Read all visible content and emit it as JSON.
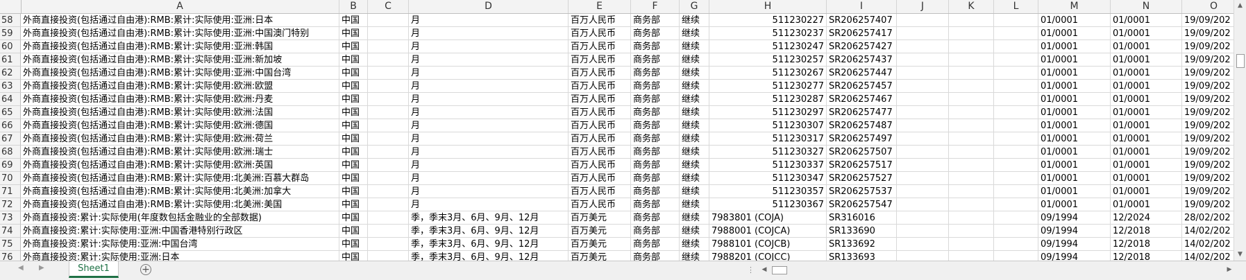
{
  "columns": [
    "A",
    "B",
    "C",
    "D",
    "E",
    "F",
    "G",
    "H",
    "I",
    "J",
    "K",
    "L",
    "M",
    "N",
    "O"
  ],
  "rows": [
    {
      "n": "58",
      "cells": [
        "外商直接投资(包括通过自由港):RMB:累计:实际使用:亚洲:日本",
        "中国",
        "",
        "月",
        "百万人民币",
        "商务部",
        "继续",
        "511230227",
        "SR206257407",
        "",
        "",
        "",
        "01/0001",
        "01/0001",
        "19/09/202"
      ]
    },
    {
      "n": "59",
      "cells": [
        "外商直接投资(包括通过自由港):RMB:累计:实际使用:亚洲:中国澳门特别",
        "中国",
        "",
        "月",
        "百万人民币",
        "商务部",
        "继续",
        "511230237",
        "SR206257417",
        "",
        "",
        "",
        "01/0001",
        "01/0001",
        "19/09/202"
      ]
    },
    {
      "n": "60",
      "cells": [
        "外商直接投资(包括通过自由港):RMB:累计:实际使用:亚洲:韩国",
        "中国",
        "",
        "月",
        "百万人民币",
        "商务部",
        "继续",
        "511230247",
        "SR206257427",
        "",
        "",
        "",
        "01/0001",
        "01/0001",
        "19/09/202"
      ]
    },
    {
      "n": "61",
      "cells": [
        "外商直接投资(包括通过自由港):RMB:累计:实际使用:亚洲:新加坡",
        "中国",
        "",
        "月",
        "百万人民币",
        "商务部",
        "继续",
        "511230257",
        "SR206257437",
        "",
        "",
        "",
        "01/0001",
        "01/0001",
        "19/09/202"
      ]
    },
    {
      "n": "62",
      "cells": [
        "外商直接投资(包括通过自由港):RMB:累计:实际使用:亚洲:中国台湾",
        "中国",
        "",
        "月",
        "百万人民币",
        "商务部",
        "继续",
        "511230267",
        "SR206257447",
        "",
        "",
        "",
        "01/0001",
        "01/0001",
        "19/09/202"
      ]
    },
    {
      "n": "63",
      "cells": [
        "外商直接投资(包括通过自由港):RMB:累计:实际使用:欧洲:欧盟",
        "中国",
        "",
        "月",
        "百万人民币",
        "商务部",
        "继续",
        "511230277",
        "SR206257457",
        "",
        "",
        "",
        "01/0001",
        "01/0001",
        "19/09/202"
      ]
    },
    {
      "n": "64",
      "cells": [
        "外商直接投资(包括通过自由港):RMB:累计:实际使用:欧洲:丹麦",
        "中国",
        "",
        "月",
        "百万人民币",
        "商务部",
        "继续",
        "511230287",
        "SR206257467",
        "",
        "",
        "",
        "01/0001",
        "01/0001",
        "19/09/202"
      ]
    },
    {
      "n": "65",
      "cells": [
        "外商直接投资(包括通过自由港):RMB:累计:实际使用:欧洲:法国",
        "中国",
        "",
        "月",
        "百万人民币",
        "商务部",
        "继续",
        "511230297",
        "SR206257477",
        "",
        "",
        "",
        "01/0001",
        "01/0001",
        "19/09/202"
      ]
    },
    {
      "n": "66",
      "cells": [
        "外商直接投资(包括通过自由港):RMB:累计:实际使用:欧洲:德国",
        "中国",
        "",
        "月",
        "百万人民币",
        "商务部",
        "继续",
        "511230307",
        "SR206257487",
        "",
        "",
        "",
        "01/0001",
        "01/0001",
        "19/09/202"
      ]
    },
    {
      "n": "67",
      "cells": [
        "外商直接投资(包括通过自由港):RMB:累计:实际使用:欧洲:荷兰",
        "中国",
        "",
        "月",
        "百万人民币",
        "商务部",
        "继续",
        "511230317",
        "SR206257497",
        "",
        "",
        "",
        "01/0001",
        "01/0001",
        "19/09/202"
      ]
    },
    {
      "n": "68",
      "cells": [
        "外商直接投资(包括通过自由港):RMB:累计:实际使用:欧洲:瑞士",
        "中国",
        "",
        "月",
        "百万人民币",
        "商务部",
        "继续",
        "511230327",
        "SR206257507",
        "",
        "",
        "",
        "01/0001",
        "01/0001",
        "19/09/202"
      ]
    },
    {
      "n": "69",
      "cells": [
        "外商直接投资(包括通过自由港):RMB:累计:实际使用:欧洲:英国",
        "中国",
        "",
        "月",
        "百万人民币",
        "商务部",
        "继续",
        "511230337",
        "SR206257517",
        "",
        "",
        "",
        "01/0001",
        "01/0001",
        "19/09/202"
      ]
    },
    {
      "n": "70",
      "cells": [
        "外商直接投资(包括通过自由港):RMB:累计:实际使用:北美洲:百慕大群岛",
        "中国",
        "",
        "月",
        "百万人民币",
        "商务部",
        "继续",
        "511230347",
        "SR206257527",
        "",
        "",
        "",
        "01/0001",
        "01/0001",
        "19/09/202"
      ]
    },
    {
      "n": "71",
      "cells": [
        "外商直接投资(包括通过自由港):RMB:累计:实际使用:北美洲:加拿大",
        "中国",
        "",
        "月",
        "百万人民币",
        "商务部",
        "继续",
        "511230357",
        "SR206257537",
        "",
        "",
        "",
        "01/0001",
        "01/0001",
        "19/09/202"
      ]
    },
    {
      "n": "72",
      "cells": [
        "外商直接投资(包括通过自由港):RMB:累计:实际使用:北美洲:美国",
        "中国",
        "",
        "月",
        "百万人民币",
        "商务部",
        "继续",
        "511230367",
        "SR206257547",
        "",
        "",
        "",
        "01/0001",
        "01/0001",
        "19/09/202"
      ]
    },
    {
      "n": "73",
      "cells": [
        "外商直接投资:累计:实际使用(年度数包括金融业的全部数据)",
        "中国",
        "",
        "季，季末3月、6月、9月、12月",
        "百万美元",
        "商务部",
        "继续",
        "7983801 (COJA)",
        "SR316016",
        "",
        "",
        "",
        "09/1994",
        "12/2024",
        "28/02/202"
      ]
    },
    {
      "n": "74",
      "cells": [
        "外商直接投资:累计:实际使用:亚洲:中国香港特别行政区",
        "中国",
        "",
        "季，季末3月、6月、9月、12月",
        "百万美元",
        "商务部",
        "继续",
        "7988001 (COJCA)",
        "SR133690",
        "",
        "",
        "",
        "09/1994",
        "12/2018",
        "14/02/202"
      ]
    },
    {
      "n": "75",
      "cells": [
        "外商直接投资:累计:实际使用:亚洲:中国台湾",
        "中国",
        "",
        "季，季末3月、6月、9月、12月",
        "百万美元",
        "商务部",
        "继续",
        "7988101 (COJCB)",
        "SR133692",
        "",
        "",
        "",
        "09/1994",
        "12/2018",
        "14/02/202"
      ]
    },
    {
      "n": "76",
      "cells": [
        "外商直接投资:累计:实际使用:亚洲:日本",
        "中国",
        "",
        "季，季末3月、6月、9月、12月",
        "百万美元",
        "商务部",
        "继续",
        "7988201 (COJCC)",
        "SR133693",
        "",
        "",
        "",
        "09/1994",
        "12/2018",
        "14/02/202"
      ]
    }
  ],
  "sheet_tab": "Sheet1",
  "add_sheet": "+",
  "icons": {
    "nav_prev": "◀",
    "nav_next": "▶",
    "scroll_up": "▲",
    "scroll_down": "▼",
    "scroll_left": "◀",
    "scroll_right": "▶",
    "dots": "⋮"
  },
  "colors": {
    "accent": "#1e7145"
  }
}
